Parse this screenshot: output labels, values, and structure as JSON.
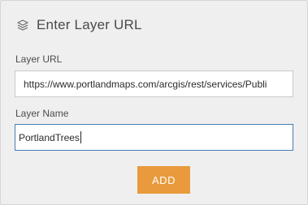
{
  "dialog": {
    "title": "Enter Layer URL",
    "title_icon": "layers-icon"
  },
  "layer_url": {
    "label": "Layer URL",
    "value": "https://www.portlandmaps.com/arcgis/rest/services/Publi"
  },
  "layer_name": {
    "label": "Layer Name",
    "value": "PortlandTrees"
  },
  "actions": {
    "add_label": "ADD"
  },
  "colors": {
    "accent": "#e89a3c",
    "focus_border": "#4a7bb0",
    "panel_background": "#efefef"
  }
}
